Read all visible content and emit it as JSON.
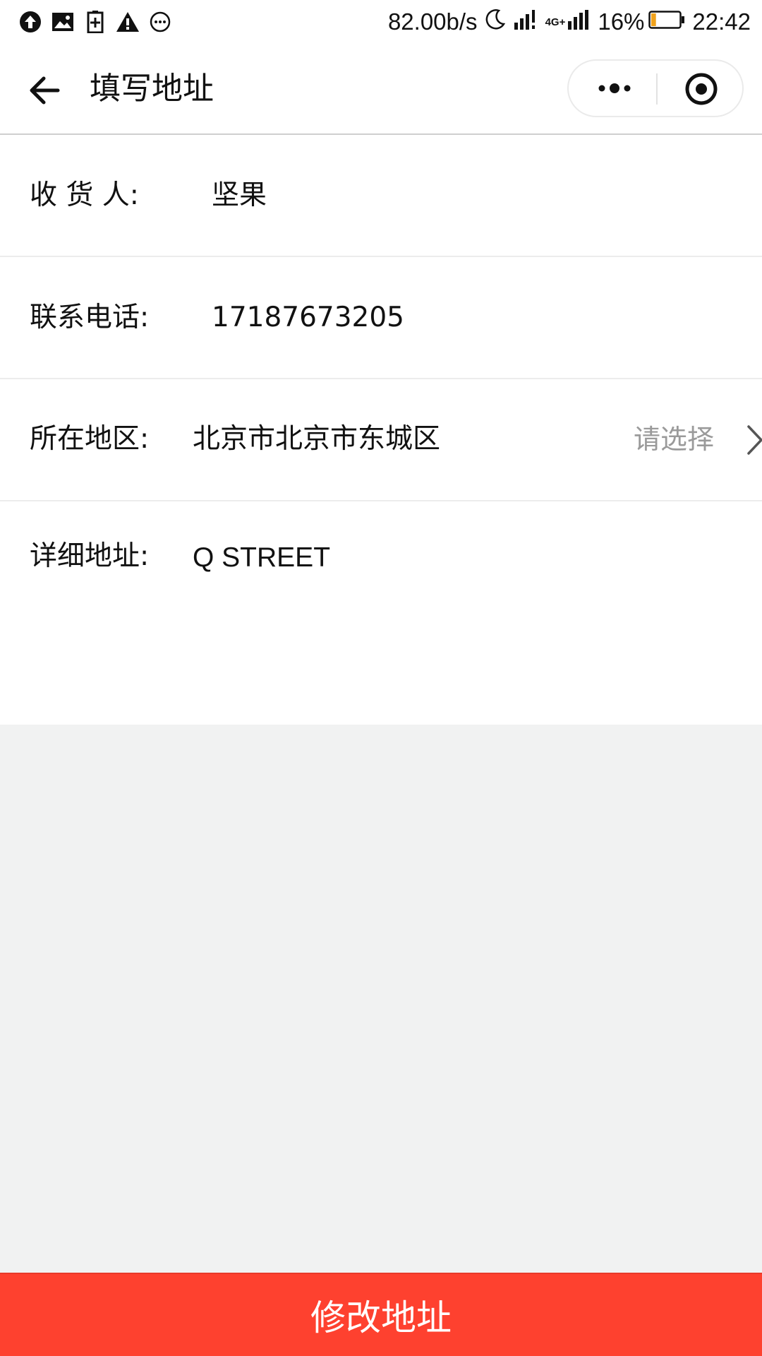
{
  "status_bar": {
    "left_icons": [
      "upload-icon",
      "image-icon",
      "battery-saver-icon",
      "warning-icon",
      "more-circle-icon"
    ],
    "net_speed": "82.00b/s",
    "network_label": "4G+",
    "battery_percent": "16%",
    "time": "22:42",
    "battery_level_percent": 16,
    "battery_color": "#f0a21c"
  },
  "navbar": {
    "title": "填写地址",
    "back_icon": "arrow-left-icon",
    "more_icon": "more-dots-icon",
    "close_icon": "target-circle-icon"
  },
  "form": {
    "recipient": {
      "label": "收 货 人:",
      "value": "坚果"
    },
    "phone": {
      "label": "联系电话:",
      "value": "17187673205"
    },
    "region": {
      "label": "所在地区:",
      "value": "北京市北京市东城区",
      "hint": "请选择"
    },
    "detail": {
      "label": "详细地址:",
      "value": "Q STREET"
    }
  },
  "submit": {
    "label": "修改地址",
    "color": "#fe412f"
  },
  "colors": {
    "page_background": "#f1f2f2",
    "hint_text": "#9a9a9a"
  }
}
